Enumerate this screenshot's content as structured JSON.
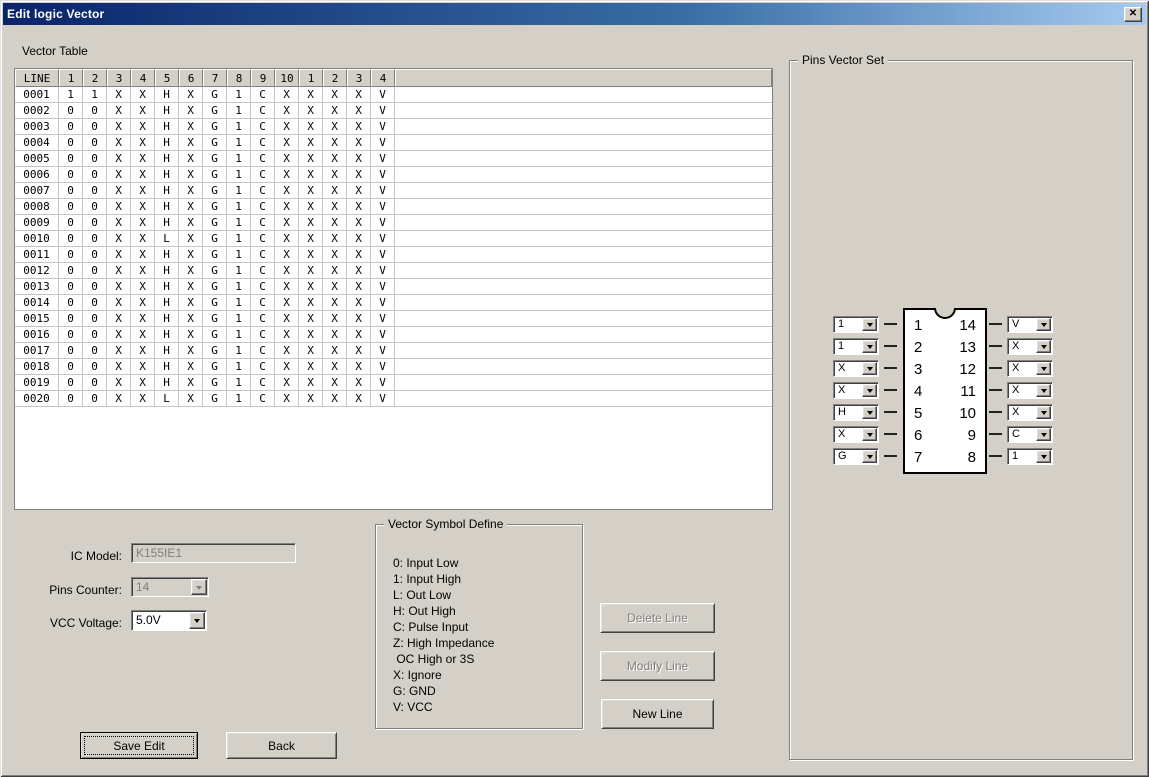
{
  "window": {
    "title": "Edit logic Vector",
    "close_glyph": "✕"
  },
  "colors": {
    "titlebar_left": "#0a246a",
    "titlebar_right": "#a6caf0",
    "chrome": "#d4d0c8"
  },
  "vector_table": {
    "label": "Vector Table",
    "headers": [
      "LINE",
      "1",
      "2",
      "3",
      "4",
      "5",
      "6",
      "7",
      "8",
      "9",
      "10",
      "1",
      "2",
      "3",
      "4"
    ],
    "rows": [
      [
        "0001",
        "1",
        "1",
        "X",
        "X",
        "H",
        "X",
        "G",
        "1",
        "C",
        "X",
        "X",
        "X",
        "X",
        "V"
      ],
      [
        "0002",
        "0",
        "0",
        "X",
        "X",
        "H",
        "X",
        "G",
        "1",
        "C",
        "X",
        "X",
        "X",
        "X",
        "V"
      ],
      [
        "0003",
        "0",
        "0",
        "X",
        "X",
        "H",
        "X",
        "G",
        "1",
        "C",
        "X",
        "X",
        "X",
        "X",
        "V"
      ],
      [
        "0004",
        "0",
        "0",
        "X",
        "X",
        "H",
        "X",
        "G",
        "1",
        "C",
        "X",
        "X",
        "X",
        "X",
        "V"
      ],
      [
        "0005",
        "0",
        "0",
        "X",
        "X",
        "H",
        "X",
        "G",
        "1",
        "C",
        "X",
        "X",
        "X",
        "X",
        "V"
      ],
      [
        "0006",
        "0",
        "0",
        "X",
        "X",
        "H",
        "X",
        "G",
        "1",
        "C",
        "X",
        "X",
        "X",
        "X",
        "V"
      ],
      [
        "0007",
        "0",
        "0",
        "X",
        "X",
        "H",
        "X",
        "G",
        "1",
        "C",
        "X",
        "X",
        "X",
        "X",
        "V"
      ],
      [
        "0008",
        "0",
        "0",
        "X",
        "X",
        "H",
        "X",
        "G",
        "1",
        "C",
        "X",
        "X",
        "X",
        "X",
        "V"
      ],
      [
        "0009",
        "0",
        "0",
        "X",
        "X",
        "H",
        "X",
        "G",
        "1",
        "C",
        "X",
        "X",
        "X",
        "X",
        "V"
      ],
      [
        "0010",
        "0",
        "0",
        "X",
        "X",
        "L",
        "X",
        "G",
        "1",
        "C",
        "X",
        "X",
        "X",
        "X",
        "V"
      ],
      [
        "0011",
        "0",
        "0",
        "X",
        "X",
        "H",
        "X",
        "G",
        "1",
        "C",
        "X",
        "X",
        "X",
        "X",
        "V"
      ],
      [
        "0012",
        "0",
        "0",
        "X",
        "X",
        "H",
        "X",
        "G",
        "1",
        "C",
        "X",
        "X",
        "X",
        "X",
        "V"
      ],
      [
        "0013",
        "0",
        "0",
        "X",
        "X",
        "H",
        "X",
        "G",
        "1",
        "C",
        "X",
        "X",
        "X",
        "X",
        "V"
      ],
      [
        "0014",
        "0",
        "0",
        "X",
        "X",
        "H",
        "X",
        "G",
        "1",
        "C",
        "X",
        "X",
        "X",
        "X",
        "V"
      ],
      [
        "0015",
        "0",
        "0",
        "X",
        "X",
        "H",
        "X",
        "G",
        "1",
        "C",
        "X",
        "X",
        "X",
        "X",
        "V"
      ],
      [
        "0016",
        "0",
        "0",
        "X",
        "X",
        "H",
        "X",
        "G",
        "1",
        "C",
        "X",
        "X",
        "X",
        "X",
        "V"
      ],
      [
        "0017",
        "0",
        "0",
        "X",
        "X",
        "H",
        "X",
        "G",
        "1",
        "C",
        "X",
        "X",
        "X",
        "X",
        "V"
      ],
      [
        "0018",
        "0",
        "0",
        "X",
        "X",
        "H",
        "X",
        "G",
        "1",
        "C",
        "X",
        "X",
        "X",
        "X",
        "V"
      ],
      [
        "0019",
        "0",
        "0",
        "X",
        "X",
        "H",
        "X",
        "G",
        "1",
        "C",
        "X",
        "X",
        "X",
        "X",
        "V"
      ],
      [
        "0020",
        "0",
        "0",
        "X",
        "X",
        "L",
        "X",
        "G",
        "1",
        "C",
        "X",
        "X",
        "X",
        "X",
        "V"
      ]
    ]
  },
  "pins_vector_set": {
    "label": "Pins Vector Set",
    "left_pins": [
      {
        "pin": "1",
        "value": "1"
      },
      {
        "pin": "2",
        "value": "1"
      },
      {
        "pin": "3",
        "value": "X"
      },
      {
        "pin": "4",
        "value": "X"
      },
      {
        "pin": "5",
        "value": "H"
      },
      {
        "pin": "6",
        "value": "X"
      },
      {
        "pin": "7",
        "value": "G"
      }
    ],
    "right_pins": [
      {
        "pin": "14",
        "value": "V"
      },
      {
        "pin": "13",
        "value": "X"
      },
      {
        "pin": "12",
        "value": "X"
      },
      {
        "pin": "11",
        "value": "X"
      },
      {
        "pin": "10",
        "value": "X"
      },
      {
        "pin": "9",
        "value": "C"
      },
      {
        "pin": "8",
        "value": "1"
      }
    ]
  },
  "controls": {
    "ic_model_label": "IC Model:",
    "ic_model_value": "K155IE1",
    "pins_counter_label": "Pins Counter:",
    "pins_counter_value": "14",
    "vcc_voltage_label": "VCC Voltage:",
    "vcc_voltage_value": "5.0V"
  },
  "symbol_define": {
    "label": "Vector Symbol Define",
    "lines": [
      "0: Input Low",
      "1: Input High",
      "L: Out Low",
      "H: Out High",
      "C: Pulse Input",
      "Z: High Impedance",
      " OC High or 3S",
      "X: Ignore",
      "G: GND",
      "V: VCC"
    ]
  },
  "buttons": {
    "delete_line": "Delete Line",
    "modify_line": "Modify Line",
    "new_line": "New Line",
    "save_edit": "Save Edit",
    "back": "Back"
  }
}
